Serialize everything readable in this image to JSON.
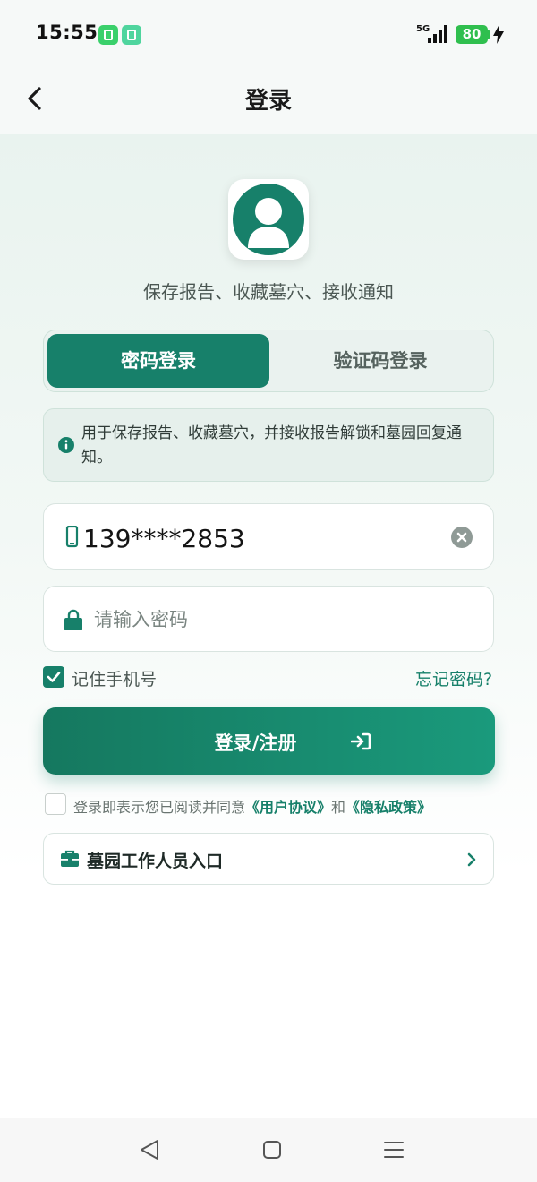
{
  "status_bar": {
    "time": "15:55",
    "network": "5G",
    "battery": "80"
  },
  "header": {
    "title": "登录"
  },
  "tagline": "保存报告、收藏墓穴、接收通知",
  "tabs": [
    {
      "label": "密码登录",
      "active": true
    },
    {
      "label": "验证码登录",
      "active": false
    }
  ],
  "notice": "用于保存报告、收藏墓穴，并接收报告解锁和墓园回复通知。",
  "phone_field": {
    "value": "139****2853"
  },
  "password_field": {
    "placeholder": "请输入密码"
  },
  "remember": {
    "label": "记住手机号",
    "checked": true
  },
  "forgot_label": "忘记密码?",
  "login_button": "登录/注册",
  "agreement": {
    "prefix": "登录即表示您已阅读并同意",
    "user_agreement": "《用户协议》",
    "and": "和",
    "privacy_policy": "《隐私政策》",
    "checked": false
  },
  "staff_entry": "墓园工作人员入口",
  "colors": {
    "primary": "#17806a",
    "primary_light": "#1a9a7c",
    "notice_bg": "#e6f0ec"
  }
}
